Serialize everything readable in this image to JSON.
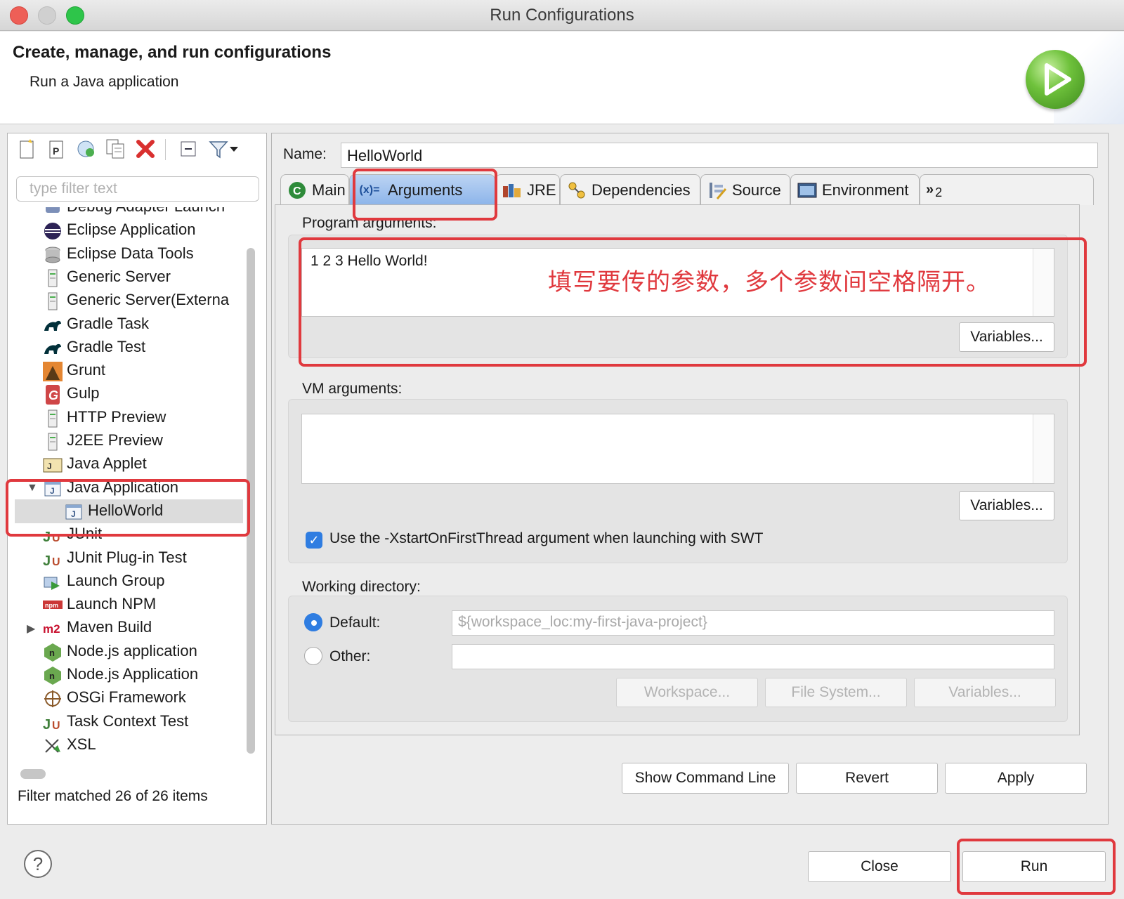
{
  "window": {
    "title": "Run Configurations"
  },
  "header": {
    "title": "Create, manage, and run configurations",
    "subtitle": "Run a Java application"
  },
  "colors": {
    "annotation": "#e0393e",
    "accent": "#2f7de1",
    "tab_active": "#8cb4ea"
  },
  "sidebar": {
    "toolbar_icons": [
      "new-config-icon",
      "new-prototype-icon",
      "export-icon",
      "duplicate-icon",
      "delete-icon",
      "collapse-all-icon",
      "filter-icon",
      "dropdown-icon"
    ],
    "filter_placeholder": "type filter text",
    "items": [
      {
        "label": "Debug Adapter Launch",
        "icon": "debug-adapter-icon"
      },
      {
        "label": "Eclipse Application",
        "icon": "eclipse-icon"
      },
      {
        "label": "Eclipse Data Tools",
        "icon": "database-icon"
      },
      {
        "label": "Generic Server",
        "icon": "server-icon"
      },
      {
        "label": "Generic Server(Externa",
        "icon": "server-icon"
      },
      {
        "label": "Gradle Task",
        "icon": "gradle-icon"
      },
      {
        "label": "Gradle Test",
        "icon": "gradle-icon"
      },
      {
        "label": "Grunt",
        "icon": "grunt-icon"
      },
      {
        "label": "Gulp",
        "icon": "gulp-icon"
      },
      {
        "label": "HTTP Preview",
        "icon": "server-icon"
      },
      {
        "label": "J2EE Preview",
        "icon": "server-icon"
      },
      {
        "label": "Java Applet",
        "icon": "applet-icon"
      },
      {
        "label": "Java Application",
        "icon": "java-app-icon",
        "expanded": true
      },
      {
        "label": "HelloWorld",
        "icon": "java-app-icon",
        "child": true,
        "selected": true
      },
      {
        "label": "JUnit",
        "icon": "junit-icon"
      },
      {
        "label": "JUnit Plug-in Test",
        "icon": "junit-icon"
      },
      {
        "label": "Launch Group",
        "icon": "launch-group-icon"
      },
      {
        "label": "Launch NPM",
        "icon": "npm-icon"
      },
      {
        "label": "Maven Build",
        "icon": "maven-icon",
        "collapsed": true
      },
      {
        "label": "Node.js application",
        "icon": "nodejs-icon"
      },
      {
        "label": "Node.js Application",
        "icon": "nodejs-icon"
      },
      {
        "label": "OSGi Framework",
        "icon": "osgi-icon"
      },
      {
        "label": "Task Context Test",
        "icon": "junit-icon"
      },
      {
        "label": "XSL",
        "icon": "xsl-icon"
      }
    ],
    "status": "Filter matched 26 of 26 items"
  },
  "main": {
    "name_label": "Name:",
    "name_value": "HelloWorld",
    "tabs": [
      {
        "label": "Main",
        "icon": "main-class-icon"
      },
      {
        "label": "Arguments",
        "icon": "arguments-icon",
        "prefix": "(x)="
      },
      {
        "label": "JRE",
        "icon": "jre-icon"
      },
      {
        "label": "Dependencies",
        "icon": "dependencies-icon"
      },
      {
        "label": "Source",
        "icon": "source-icon"
      },
      {
        "label": "Environment",
        "icon": "environment-icon"
      },
      {
        "label": "2",
        "icon": "more-tabs-icon",
        "prefix": "»"
      }
    ],
    "program_args_label": "Program arguments:",
    "program_args_value": "1 2 3 Hello World!",
    "program_args_note": "填写要传的参数，多个参数间空格隔开。",
    "variables_label": "Variables...",
    "vm_args_label": "VM arguments:",
    "vm_args_value": "",
    "xstart_checkbox_label": "Use the -XstartOnFirstThread argument when launching with SWT",
    "xstart_checked": true,
    "working_dir_label": "Working directory:",
    "default_label": "Default:",
    "default_value": "${workspace_loc:my-first-java-project}",
    "other_label": "Other:",
    "other_value": "",
    "workspace_button": "Workspace...",
    "filesystem_button": "File System...",
    "variables_button_disabled": "Variables...",
    "show_command_line": "Show Command Line",
    "revert": "Revert",
    "apply": "Apply"
  },
  "footer": {
    "close": "Close",
    "run": "Run",
    "help_icon": "help-icon"
  }
}
